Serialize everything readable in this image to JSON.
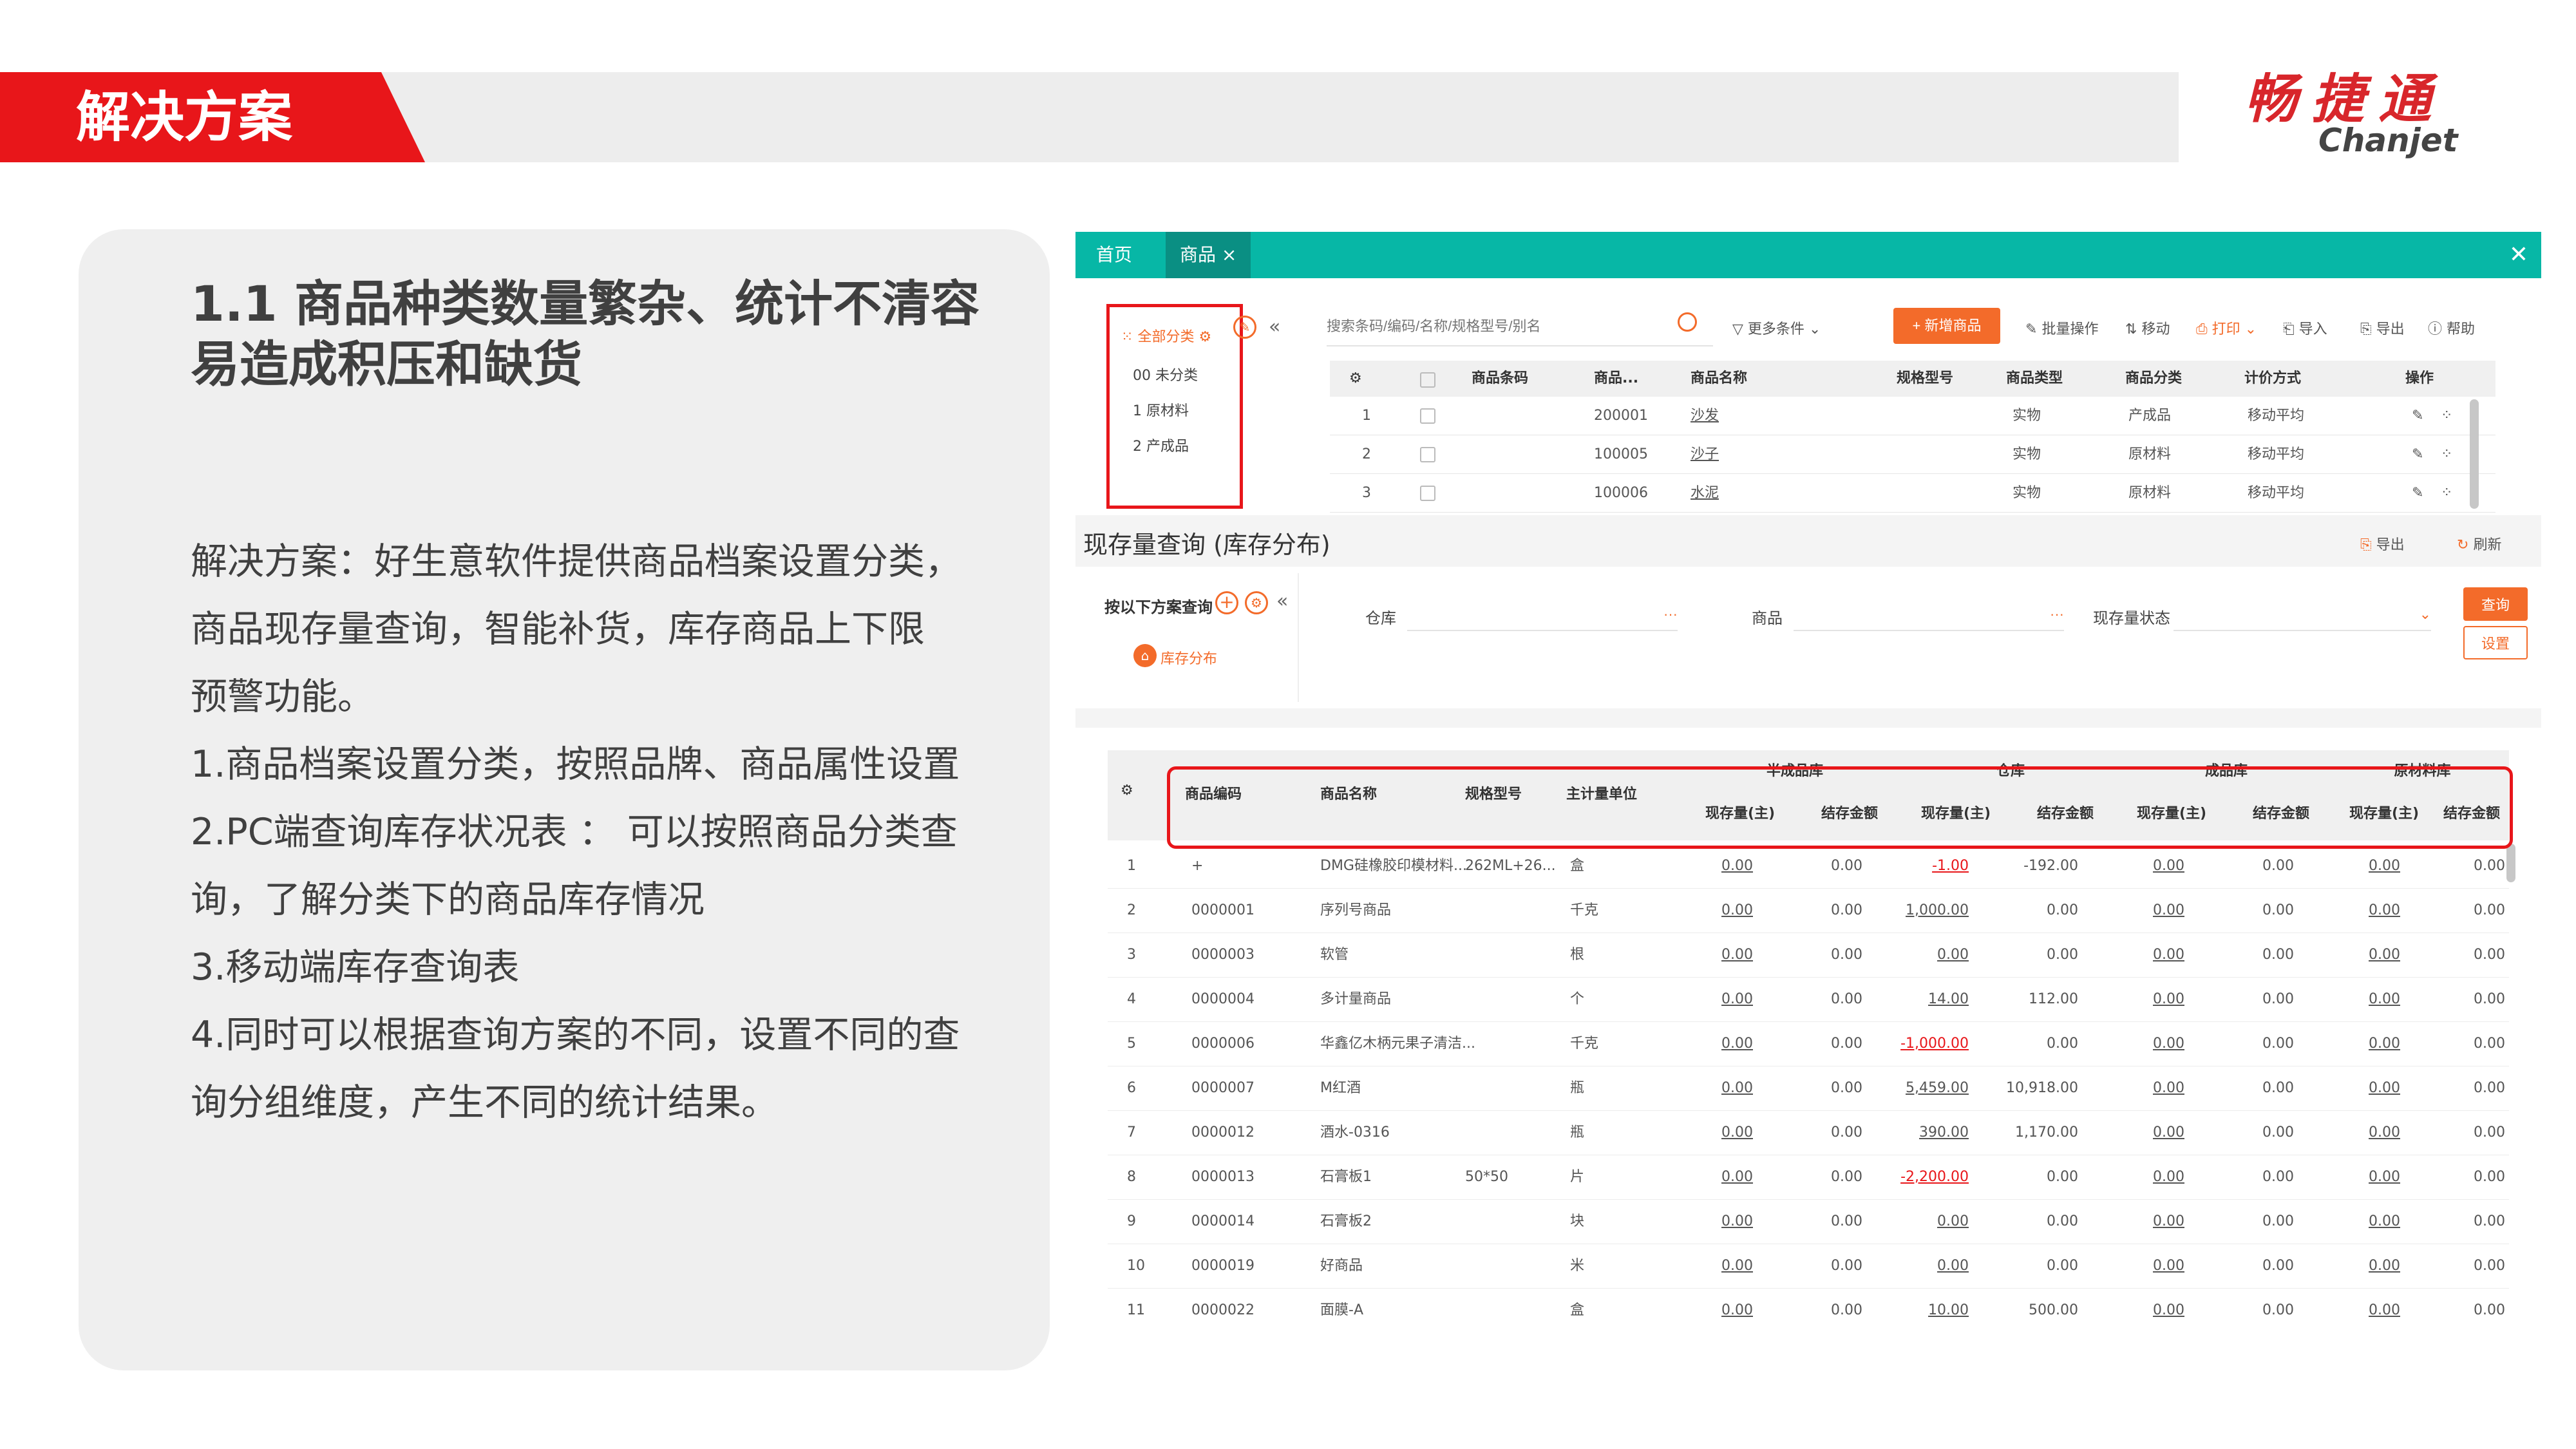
{
  "slide": {
    "section_title": "解决方案",
    "logo_cn": "畅捷通",
    "logo_en": "Chanjet",
    "card_title": "1.1 商品种类数量繁杂、统计不清容易造成积压和缺货",
    "body_lines": [
      "解决方案：好生意软件提供商品档案设置分类，",
      "商品现存量查询，智能补货，库存商品上下限",
      "预警功能。",
      "1.商品档案设置分类，按照品牌、商品属性设置",
      "2.PC端查询库存状况表 ： 可以按照商品分类查",
      "询，了解分类下的商品库存情况",
      "3.移动端库存查询表",
      "4.同时可以根据查询方案的不同，设置不同的查",
      "询分组维度，产生不同的统计结果。"
    ]
  },
  "app": {
    "tabs": [
      "首页",
      "商品"
    ],
    "categories": {
      "all": "全部分类",
      "items": [
        "00 未分类",
        "1 原材料",
        "2 产成品"
      ]
    },
    "search_placeholder": "搜索条码/编码/名称/规格型号/别名",
    "more_conditions": "更多条件",
    "new_button": "+ 新增商品",
    "tools": [
      "批量操作",
      "移动",
      "打印",
      "导入",
      "导出",
      "帮助"
    ],
    "goods_headers": [
      "商品条码",
      "商品...",
      "商品名称",
      "规格型号",
      "商品类型",
      "商品分类",
      "计价方式",
      "操作"
    ],
    "goods_rows": [
      {
        "no": "1",
        "code": "200001",
        "name": "沙发",
        "type": "实物",
        "cat": "产成品",
        "cost": "移动平均"
      },
      {
        "no": "2",
        "code": "100005",
        "name": "沙子",
        "type": "实物",
        "cat": "原材料",
        "cost": "移动平均"
      },
      {
        "no": "3",
        "code": "100006",
        "name": "水泥",
        "type": "实物",
        "cat": "原材料",
        "cost": "移动平均"
      }
    ],
    "inventory": {
      "title": "现存量查询 (库存分布)",
      "export": "导出",
      "refresh": "刷新",
      "scheme_label": "按以下方案查询",
      "dist_label": "库存分布",
      "filters": {
        "warehouse": "仓库",
        "goods": "商品",
        "status": "现存量状态"
      },
      "query_button": "查询",
      "settings_button": "设置",
      "fixed_headers": [
        "商品编码",
        "商品名称",
        "规格型号",
        "主计量单位"
      ],
      "group_headers": [
        "半成品库",
        "仓库",
        "成品库",
        "原材料库"
      ],
      "sub_headers": [
        "现存量(主)",
        "结存金额"
      ],
      "rows": [
        {
          "no": "1",
          "code": "+",
          "name": "DMG硅橡胶印模材料...",
          "spec": "262ML+26...",
          "unit": "盒",
          "vals": [
            "0.00",
            "0.00",
            "-1.00",
            "-192.00",
            "0.00",
            "0.00",
            "0.00",
            "0.00"
          ]
        },
        {
          "no": "2",
          "code": "0000001",
          "name": "序列号商品",
          "spec": "",
          "unit": "千克",
          "vals": [
            "0.00",
            "0.00",
            "1,000.00",
            "0.00",
            "0.00",
            "0.00",
            "0.00",
            "0.00"
          ]
        },
        {
          "no": "3",
          "code": "0000003",
          "name": "软管",
          "spec": "",
          "unit": "根",
          "vals": [
            "0.00",
            "0.00",
            "0.00",
            "0.00",
            "0.00",
            "0.00",
            "0.00",
            "0.00"
          ]
        },
        {
          "no": "4",
          "code": "0000004",
          "name": "多计量商品",
          "spec": "",
          "unit": "个",
          "vals": [
            "0.00",
            "0.00",
            "14.00",
            "112.00",
            "0.00",
            "0.00",
            "0.00",
            "0.00"
          ]
        },
        {
          "no": "5",
          "code": "0000006",
          "name": "华鑫亿木柄元果子清洁...",
          "spec": "",
          "unit": "千克",
          "vals": [
            "0.00",
            "0.00",
            "-1,000.00",
            "0.00",
            "0.00",
            "0.00",
            "0.00",
            "0.00"
          ]
        },
        {
          "no": "6",
          "code": "0000007",
          "name": "M红酒",
          "spec": "",
          "unit": "瓶",
          "vals": [
            "0.00",
            "0.00",
            "5,459.00",
            "10,918.00",
            "0.00",
            "0.00",
            "0.00",
            "0.00"
          ]
        },
        {
          "no": "7",
          "code": "0000012",
          "name": "酒水-0316",
          "spec": "",
          "unit": "瓶",
          "vals": [
            "0.00",
            "0.00",
            "390.00",
            "1,170.00",
            "0.00",
            "0.00",
            "0.00",
            "0.00"
          ]
        },
        {
          "no": "8",
          "code": "0000013",
          "name": "石膏板1",
          "spec": "50*50",
          "unit": "片",
          "vals": [
            "0.00",
            "0.00",
            "-2,200.00",
            "0.00",
            "0.00",
            "0.00",
            "0.00",
            "0.00"
          ]
        },
        {
          "no": "9",
          "code": "0000014",
          "name": "石膏板2",
          "spec": "",
          "unit": "块",
          "vals": [
            "0.00",
            "0.00",
            "0.00",
            "0.00",
            "0.00",
            "0.00",
            "0.00",
            "0.00"
          ]
        },
        {
          "no": "10",
          "code": "0000019",
          "name": "好商品",
          "spec": "",
          "unit": "米",
          "vals": [
            "0.00",
            "0.00",
            "0.00",
            "0.00",
            "0.00",
            "0.00",
            "0.00",
            "0.00"
          ]
        },
        {
          "no": "11",
          "code": "0000022",
          "name": "面膜-A",
          "spec": "",
          "unit": "盒",
          "vals": [
            "0.00",
            "0.00",
            "10.00",
            "500.00",
            "0.00",
            "0.00",
            "0.00",
            "0.00"
          ]
        }
      ]
    }
  }
}
